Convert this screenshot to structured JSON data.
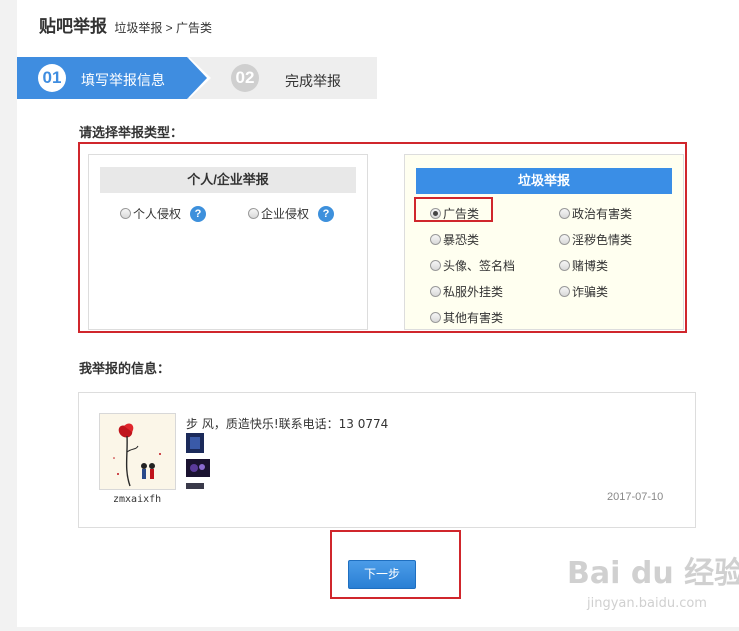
{
  "header": {
    "title": "贴吧举报",
    "breadcrumb": "垃圾举报 > 广告类"
  },
  "steps": [
    {
      "num": "01",
      "label": "填写举报信息",
      "active": true
    },
    {
      "num": "02",
      "label": "完成举报",
      "active": false
    }
  ],
  "type_section": {
    "title": "请选择举报类型："
  },
  "personal": {
    "heading": "个人/企业举报",
    "options": [
      {
        "label": "个人侵权",
        "help": "?"
      },
      {
        "label": "企业侵权",
        "help": "?"
      }
    ]
  },
  "spam": {
    "heading": "垃圾举报",
    "options": [
      {
        "label": "广告类",
        "checked": true
      },
      {
        "label": "政治有害类",
        "checked": false
      },
      {
        "label": "暴恐类",
        "checked": false
      },
      {
        "label": "淫秽色情类",
        "checked": false
      },
      {
        "label": "头像、签名档",
        "checked": false
      },
      {
        "label": "赌博类",
        "checked": false
      },
      {
        "label": "私服外挂类",
        "checked": false
      },
      {
        "label": "诈骗类",
        "checked": false
      },
      {
        "label": "其他有害类",
        "checked": false
      }
    ]
  },
  "info_section": {
    "title": "我举报的信息："
  },
  "post": {
    "username": "zmxaixfh",
    "text": "步 风，质造快乐!联系电话：13  0774",
    "date": "2017-07-10"
  },
  "next_button": {
    "label": "下一步"
  },
  "watermark": {
    "brand": "Bai du 经验",
    "url": "jingyan.baidu.com"
  },
  "colors": {
    "accent": "#3f8de0",
    "highlight_border": "#d0262c",
    "spam_panel_bg": "#fffff0"
  }
}
